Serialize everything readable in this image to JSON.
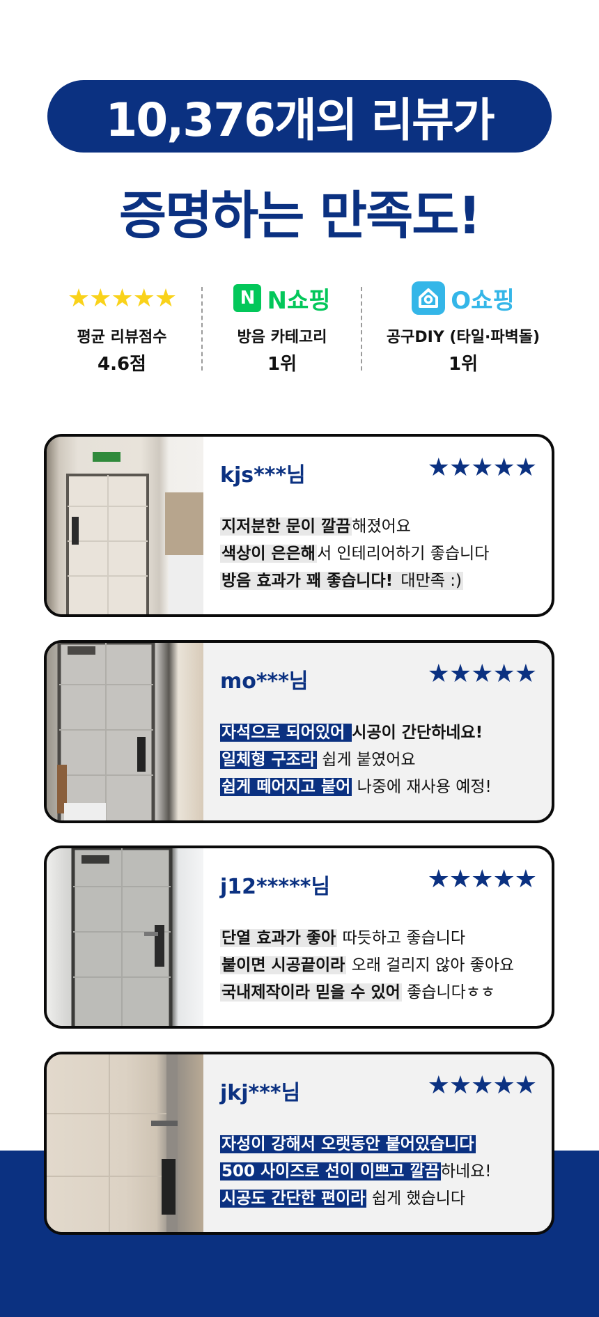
{
  "header": {
    "title_line1": "10,376개의 리뷰가",
    "title_line2": "증명하는 만족도!"
  },
  "stats": [
    {
      "icon": "five-yellow-stars",
      "stars": "★★★★★",
      "label": "평균 리뷰점수",
      "value": "4.6점"
    },
    {
      "icon": "naver-n-logo",
      "logo_letter": "N",
      "brand": "N쇼핑",
      "label": "방음 카테고리",
      "value": "1위"
    },
    {
      "icon": "o-shopping-logo",
      "brand": "O쇼핑",
      "label": "공구DIY (타일·파벽돌)",
      "value": "1위"
    }
  ],
  "colors": {
    "navy": "#0b3181",
    "naver_green": "#03c75a",
    "oshop_blue": "#34b6e8",
    "star_yellow": "#f9d21a"
  },
  "reviews": [
    {
      "user": "kjs***님",
      "stars": "★★★★★",
      "rating": 5,
      "lines": [
        {
          "hl": "지저분한 문이 깔끔",
          "rest": "해졌어요"
        },
        {
          "hl": "색상이 은은해",
          "rest": "서 인테리어하기 좋습니다"
        },
        {
          "hl": "방음 효과가 꽤 좋습니다!",
          "rest": " 대만족 :) "
        }
      ]
    },
    {
      "user": "mo***님",
      "stars": "★★★★★",
      "rating": 5,
      "lines": [
        {
          "hl": "자석으로 되어있어 ",
          "rest": "시공이 간단하네요!"
        },
        {
          "hl": "일체형 구조라",
          "rest": " 쉽게 붙였어요"
        },
        {
          "hl": "쉽게 떼어지고 붙어",
          "rest": " 나중에 재사용 예정!"
        }
      ]
    },
    {
      "user": "j12*****님",
      "stars": "★★★★★",
      "rating": 5,
      "lines": [
        {
          "hl": "단열 효과가 좋아",
          "rest": " 따듯하고 좋습니다"
        },
        {
          "hl": "붙이면 시공끝이라",
          "rest": " 오래 걸리지 않아 좋아요"
        },
        {
          "hl": "국내제작이라 믿을 수 있어",
          "rest": " 좋습니다ㅎㅎ"
        }
      ]
    },
    {
      "user": "jkj***님",
      "stars": "★★★★★",
      "rating": 5,
      "lines": [
        {
          "hl": "자성이 강해서 오랫동안 붙어있습니다 ",
          "rest": ""
        },
        {
          "hl": "500 사이즈로 선이 이쁘고 깔끔",
          "rest": "하네요!"
        },
        {
          "hl": "시공도 간단한 편이라",
          "rest": " 쉽게 했습니다"
        }
      ]
    }
  ]
}
